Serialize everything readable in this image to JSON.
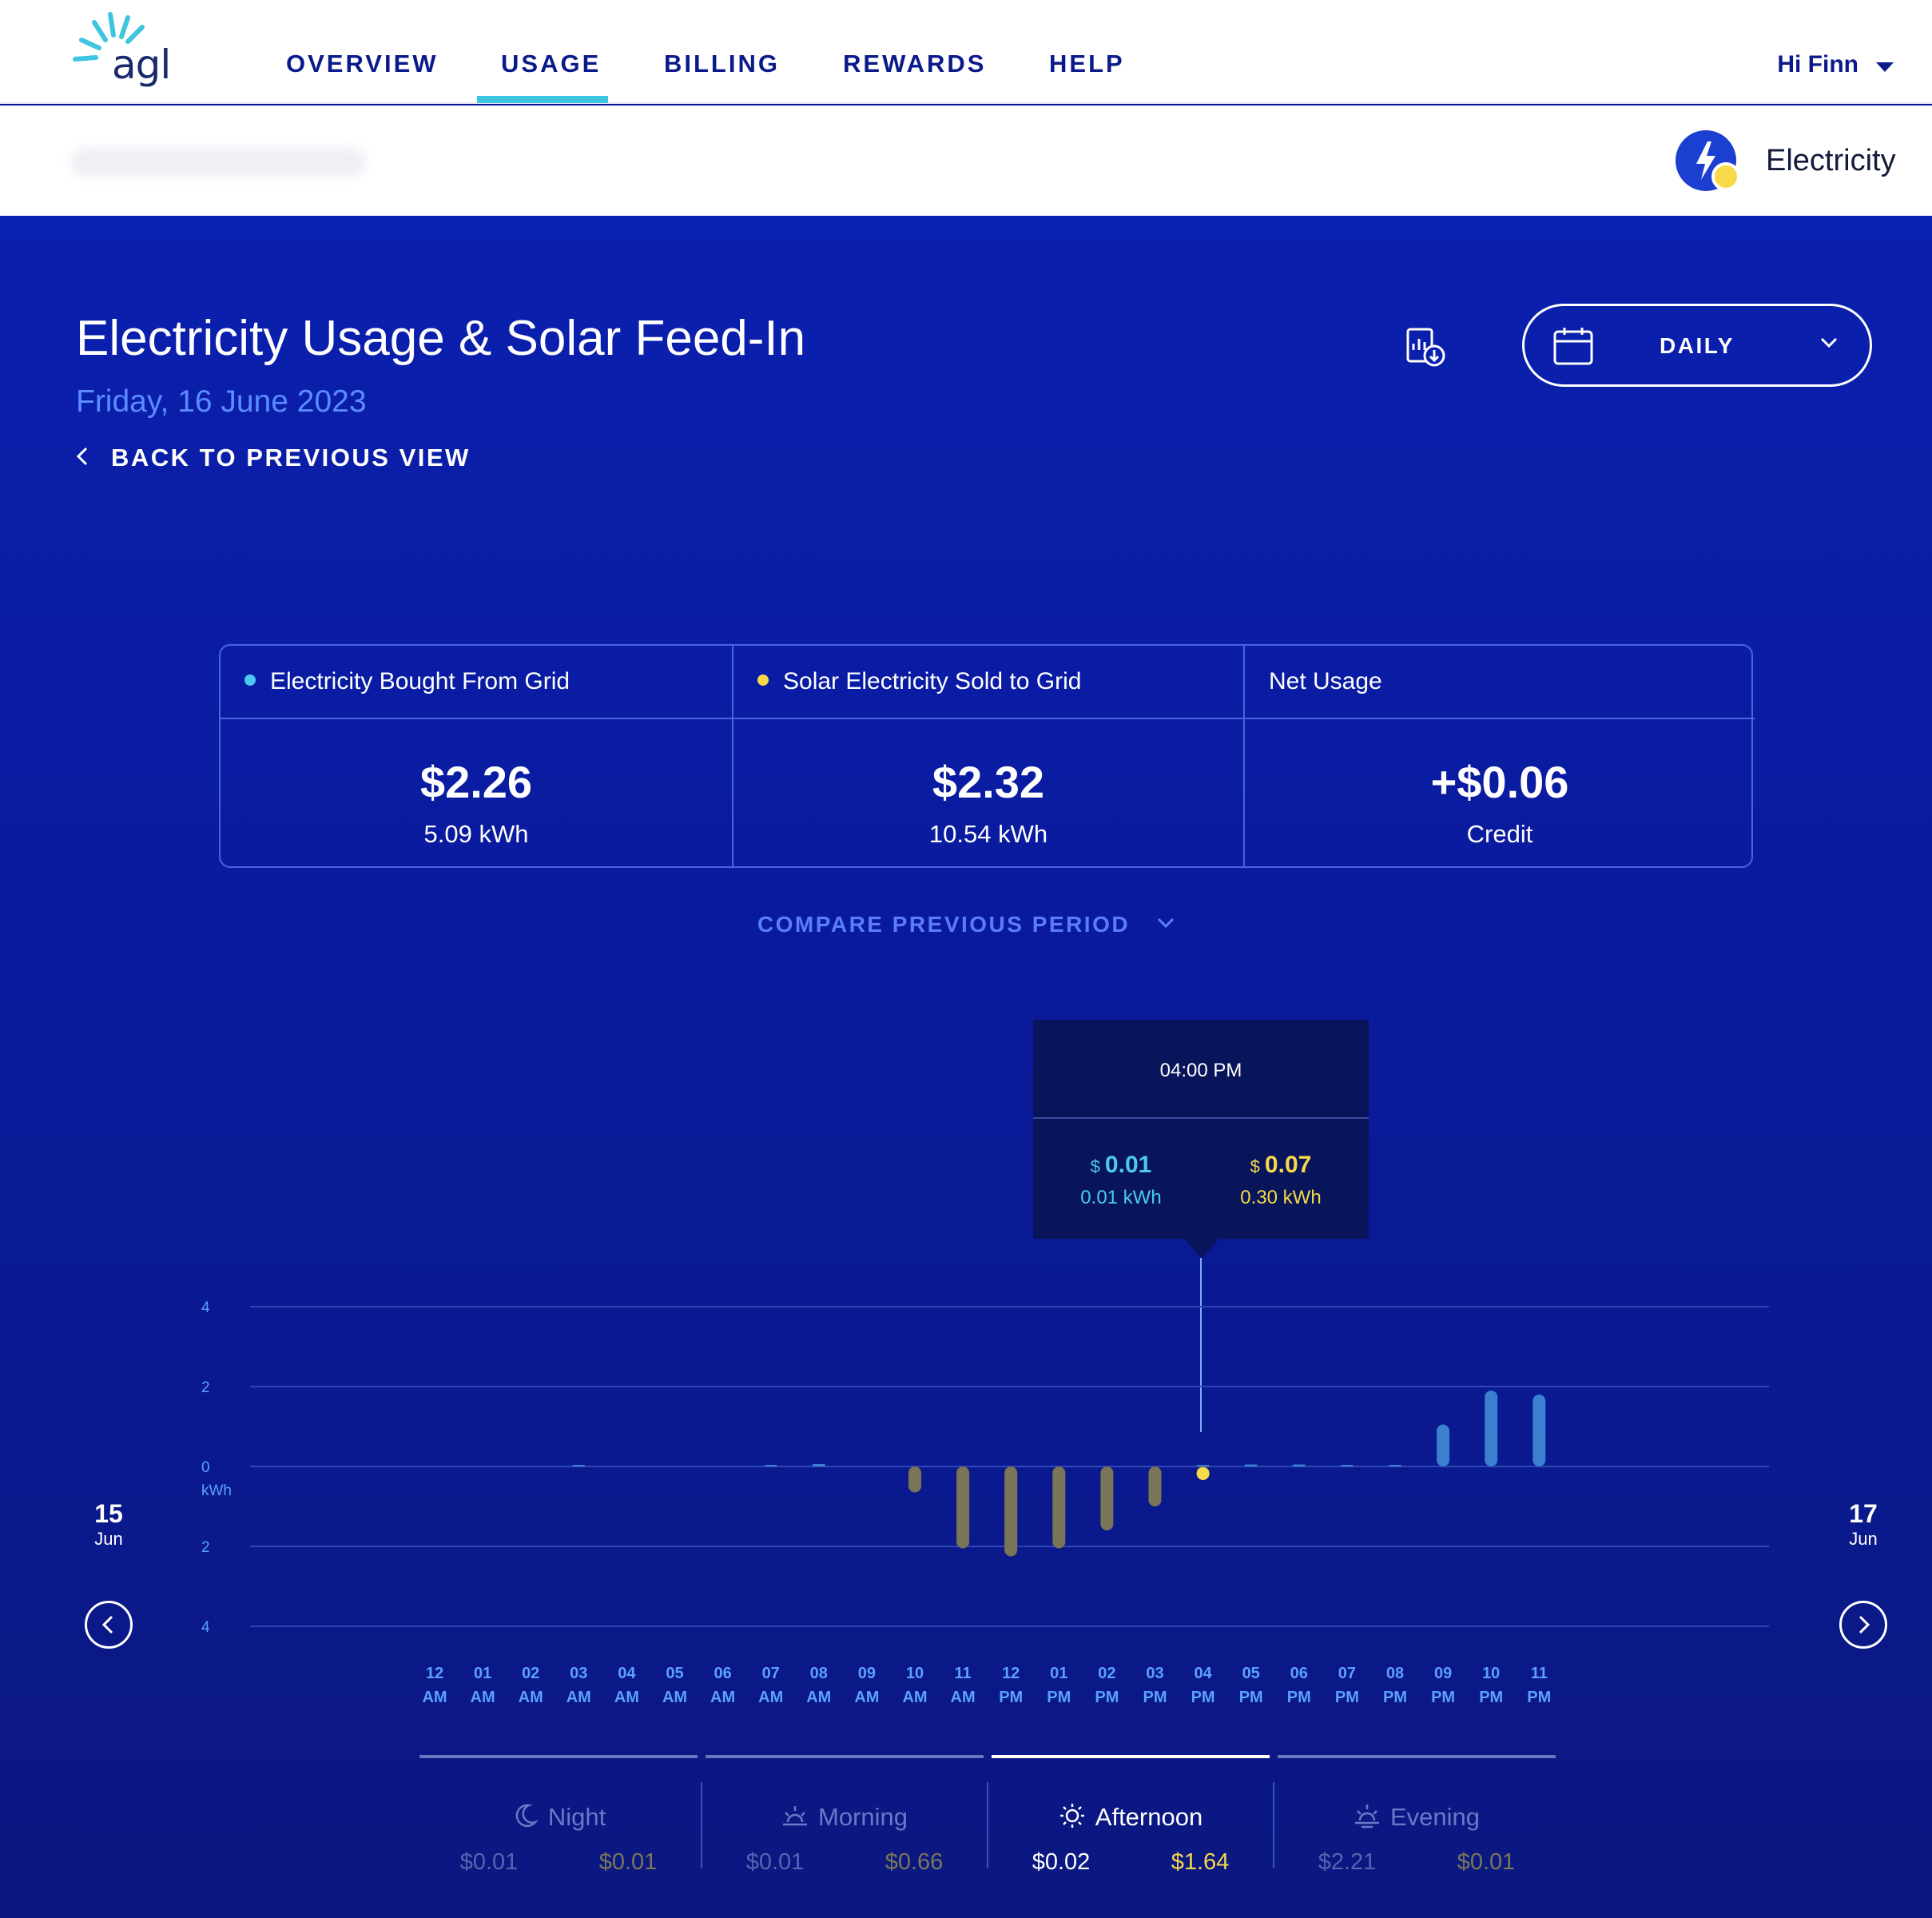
{
  "brand": {
    "logo_text": "agl"
  },
  "nav": {
    "items": [
      {
        "label": "OVERVIEW"
      },
      {
        "label": "USAGE"
      },
      {
        "label": "BILLING"
      },
      {
        "label": "REWARDS"
      },
      {
        "label": "HELP"
      }
    ],
    "active": "USAGE",
    "user_greeting": "Hi Finn"
  },
  "account": {
    "service_label": "Electricity"
  },
  "header": {
    "title": "Electricity Usage & Solar Feed-In",
    "date": "Friday, 16 June 2023",
    "back_label": "BACK TO PREVIOUS VIEW",
    "period_select": "DAILY"
  },
  "summary": {
    "bought": {
      "label": "Electricity Bought From Grid",
      "amount": "$2.26",
      "sub": "5.09 kWh",
      "color": "#4cc9f0"
    },
    "sold": {
      "label": "Solar Electricity Sold to Grid",
      "amount": "$2.32",
      "sub": "10.54 kWh",
      "color": "#f7d94a"
    },
    "net": {
      "label": "Net Usage",
      "amount": "+$0.06",
      "sub": "Credit"
    }
  },
  "compare_label": "COMPARE PREVIOUS PERIOD",
  "tooltip": {
    "time": "04:00 PM",
    "bought": {
      "currency": "$",
      "cost": "0.01",
      "kwh": "0.01 kWh"
    },
    "sold": {
      "currency": "$",
      "cost": "0.07",
      "kwh": "0.30 kWh"
    }
  },
  "day_nav": {
    "prev": {
      "day": "15",
      "month": "Jun"
    },
    "next": {
      "day": "17",
      "month": "Jun"
    }
  },
  "chart_data": {
    "type": "bar",
    "ylabel": "kWh",
    "ylim": [
      -4,
      4
    ],
    "yticks": [
      "4",
      "2",
      "0",
      "2",
      "4"
    ],
    "categories": [
      [
        "12",
        "AM"
      ],
      [
        "01",
        "AM"
      ],
      [
        "02",
        "AM"
      ],
      [
        "03",
        "AM"
      ],
      [
        "04",
        "AM"
      ],
      [
        "05",
        "AM"
      ],
      [
        "06",
        "AM"
      ],
      [
        "07",
        "AM"
      ],
      [
        "08",
        "AM"
      ],
      [
        "09",
        "AM"
      ],
      [
        "10",
        "AM"
      ],
      [
        "11",
        "AM"
      ],
      [
        "12",
        "PM"
      ],
      [
        "01",
        "PM"
      ],
      [
        "02",
        "PM"
      ],
      [
        "03",
        "PM"
      ],
      [
        "04",
        "PM"
      ],
      [
        "05",
        "PM"
      ],
      [
        "06",
        "PM"
      ],
      [
        "07",
        "PM"
      ],
      [
        "08",
        "PM"
      ],
      [
        "09",
        "PM"
      ],
      [
        "10",
        "PM"
      ],
      [
        "11",
        "PM"
      ]
    ],
    "highlighted_index": 16,
    "series": [
      {
        "key": "bought",
        "color": "#3a7fd0",
        "values": [
          0,
          0,
          0,
          0.02,
          0,
          0,
          0,
          0.03,
          0.06,
          0,
          0,
          0,
          0,
          0,
          0,
          0,
          0.01,
          0.05,
          0.05,
          0.03,
          0.04,
          1.05,
          1.9,
          1.8
        ]
      },
      {
        "key": "sold",
        "color": "#7a7458",
        "values": [
          0,
          0,
          0,
          0,
          0,
          0,
          0,
          0,
          0,
          0,
          0.65,
          2.05,
          2.25,
          2.05,
          1.6,
          1.0,
          0.3,
          0,
          0,
          0,
          0,
          0,
          0,
          0
        ]
      }
    ]
  },
  "period_tabs": [
    {
      "name": "Night",
      "bought": "$0.01",
      "sold": "$0.01",
      "icon": "moon-icon"
    },
    {
      "name": "Morning",
      "bought": "$0.01",
      "sold": "$0.66",
      "icon": "sunrise-icon"
    },
    {
      "name": "Afternoon",
      "bought": "$0.02",
      "sold": "$1.64",
      "icon": "sun-icon"
    },
    {
      "name": "Evening",
      "bought": "$2.21",
      "sold": "$0.01",
      "icon": "sunset-icon"
    }
  ],
  "active_period": "Afternoon"
}
